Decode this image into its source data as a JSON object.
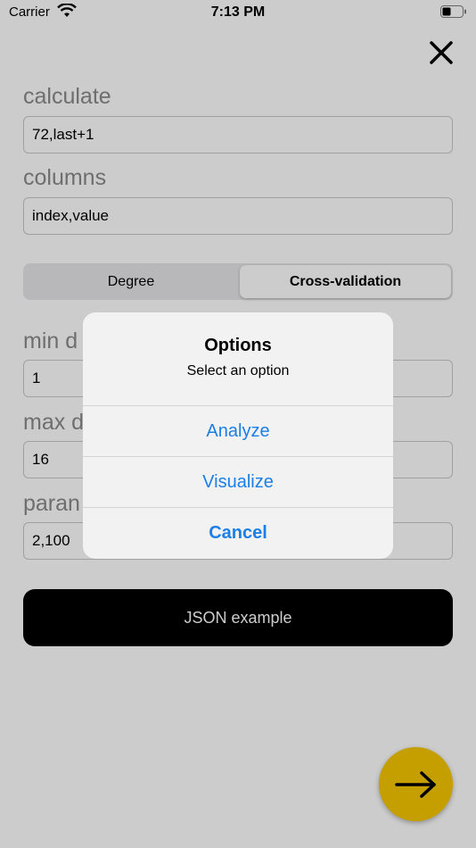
{
  "status_bar": {
    "carrier": "Carrier",
    "time": "7:13 PM"
  },
  "form": {
    "calculate_label": "calculate",
    "calculate_value": "72,last+1",
    "columns_label": "columns",
    "columns_value": "index,value",
    "segment": {
      "options": [
        "Degree",
        "Cross-validation"
      ],
      "selected": "Cross-validation"
    },
    "min_label": "min d",
    "min_value": "1",
    "max_label": "max d",
    "max_value": "16",
    "param_label": "paran",
    "param_value": "2,100"
  },
  "json_button": {
    "label": "JSON example"
  },
  "alert": {
    "title": "Options",
    "message": "Select an option",
    "actions": [
      "Analyze",
      "Visualize",
      "Cancel"
    ]
  },
  "colors": {
    "accent_blue": "#1a7fe6",
    "fab": "#f7c600",
    "json_button_bg": "#000000"
  },
  "icons": {
    "close": "close-icon",
    "next": "arrow-right-icon",
    "wifi": "wifi-icon",
    "battery": "battery-icon"
  }
}
